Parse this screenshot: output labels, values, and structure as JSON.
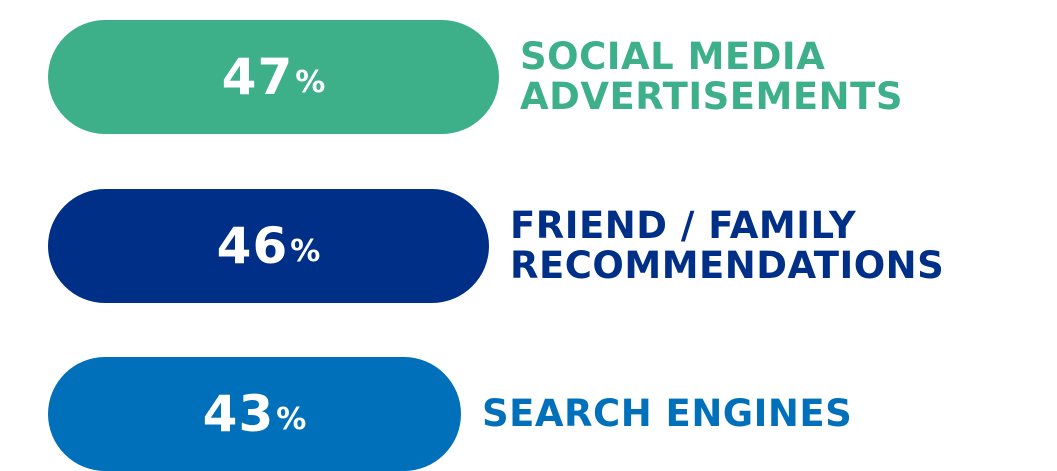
{
  "chart_data": {
    "type": "bar",
    "value_suffix": "%",
    "categories": [
      [
        "SOCIAL MEDIA",
        "ADVERTISEMENTS"
      ],
      [
        "FRIEND / FAMILY",
        "RECOMMENDATIONS"
      ],
      [
        "SEARCH ENGINES"
      ]
    ],
    "values": [
      47,
      46,
      43
    ],
    "colors": [
      "#3DB089",
      "#002F87",
      "#0070BA"
    ]
  }
}
